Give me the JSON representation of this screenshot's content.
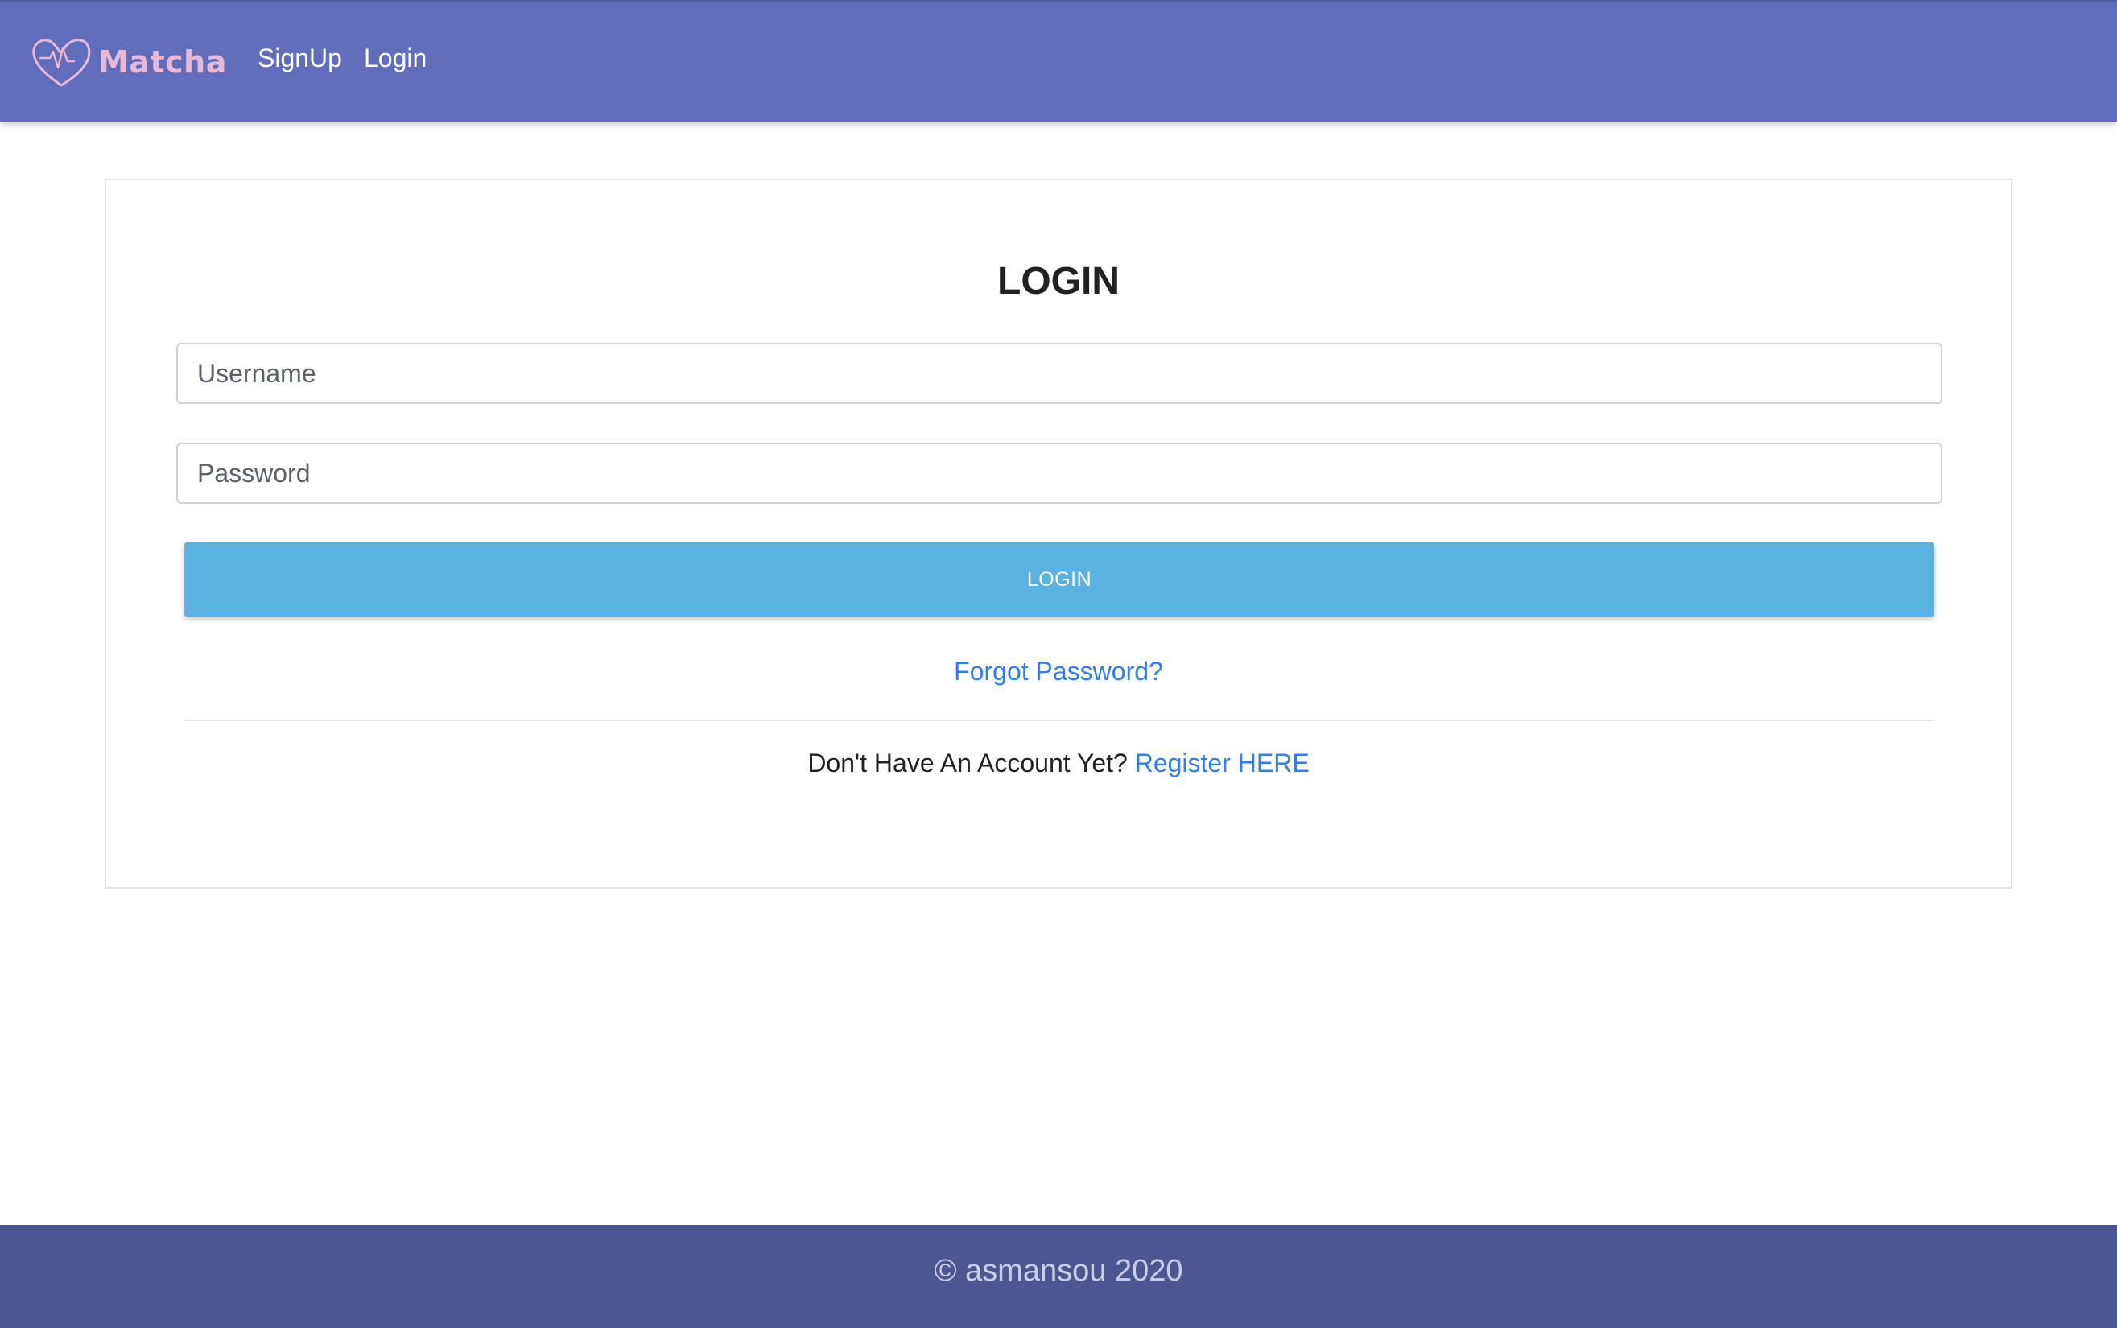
{
  "navbar": {
    "brand_name": "Matcha",
    "brand_color": "#e9b8d5",
    "background_color": "#5f6dbb",
    "links": [
      {
        "label": "SignUp"
      },
      {
        "label": "Login"
      }
    ]
  },
  "login_card": {
    "title": "LOGIN",
    "username": {
      "placeholder": "Username",
      "value": ""
    },
    "password": {
      "placeholder": "Password",
      "value": ""
    },
    "submit_label": "LOGIN",
    "submit_color": "#5ab2e0",
    "forgot_password_label": "Forgot Password?",
    "register_prompt": "Don't Have An Account Yet?",
    "register_link_label": "Register HERE",
    "link_color": "#2f7ef0"
  },
  "footer": {
    "text": "© asmansou 2020",
    "background_color": "#4b5793"
  }
}
